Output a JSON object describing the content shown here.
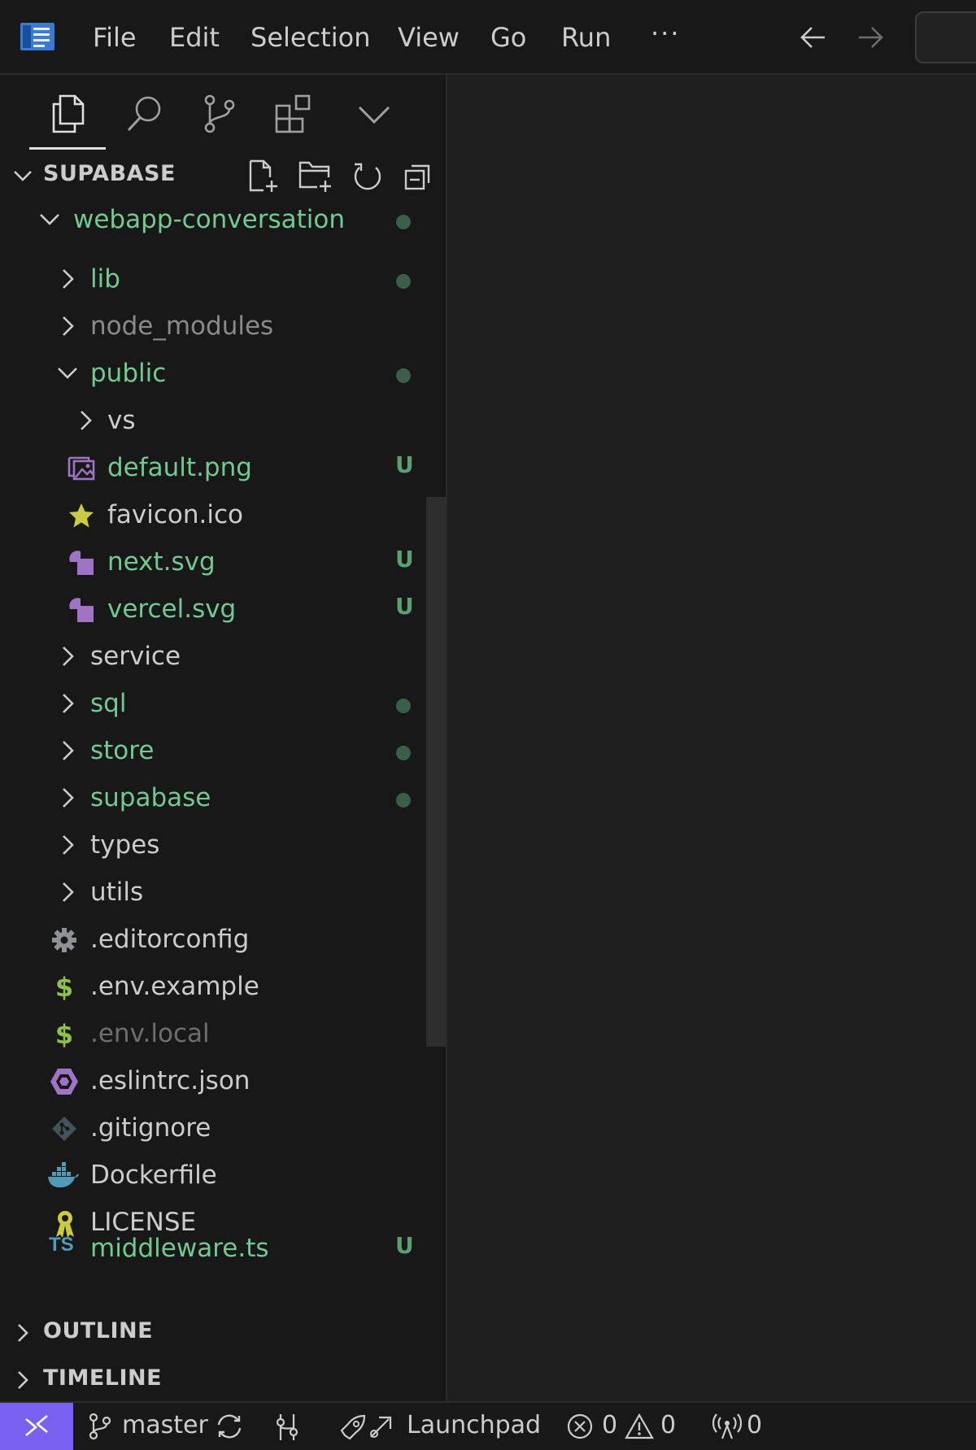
{
  "menu": {
    "items": [
      "File",
      "Edit",
      "Selection",
      "View",
      "Go",
      "Run"
    ],
    "more": "···"
  },
  "sidebar": {
    "explorer_title": "SUPABASE",
    "tree": [
      {
        "label": "webapp-conversation",
        "type": "folder",
        "expanded": true,
        "depth": 1,
        "status": "modified",
        "color": "#73c991"
      },
      {
        "label": "lib",
        "type": "folder",
        "expanded": false,
        "depth": 2,
        "status": "modified",
        "color": "#73c991"
      },
      {
        "label": "node_modules",
        "type": "folder",
        "expanded": false,
        "depth": 2,
        "status": "ignored",
        "color": "#8a8a8a"
      },
      {
        "label": "public",
        "type": "folder",
        "expanded": true,
        "depth": 2,
        "status": "modified",
        "color": "#73c991"
      },
      {
        "label": "vs",
        "type": "folder",
        "expanded": false,
        "depth": 3,
        "status": "",
        "color": "#cccccc"
      },
      {
        "label": "default.png",
        "type": "file",
        "icon": "image-icon",
        "depth": 3,
        "badge": "U",
        "color": "#73c991"
      },
      {
        "label": "favicon.ico",
        "type": "file",
        "icon": "star-icon",
        "depth": 3,
        "badge": "",
        "color": "#cccccc"
      },
      {
        "label": "next.svg",
        "type": "file",
        "icon": "svg-shapes-icon",
        "depth": 3,
        "badge": "U",
        "color": "#73c991"
      },
      {
        "label": "vercel.svg",
        "type": "file",
        "icon": "svg-shapes-icon",
        "depth": 3,
        "badge": "U",
        "color": "#73c991"
      },
      {
        "label": "service",
        "type": "folder",
        "expanded": false,
        "depth": 2,
        "status": "",
        "color": "#cccccc"
      },
      {
        "label": "sql",
        "type": "folder",
        "expanded": false,
        "depth": 2,
        "status": "modified",
        "color": "#73c991"
      },
      {
        "label": "store",
        "type": "folder",
        "expanded": false,
        "depth": 2,
        "status": "modified",
        "color": "#73c991"
      },
      {
        "label": "supabase",
        "type": "folder",
        "expanded": false,
        "depth": 2,
        "status": "modified",
        "color": "#73c991"
      },
      {
        "label": "types",
        "type": "folder",
        "expanded": false,
        "depth": 2,
        "status": "",
        "color": "#cccccc"
      },
      {
        "label": "utils",
        "type": "folder",
        "expanded": false,
        "depth": 2,
        "status": "",
        "color": "#cccccc"
      },
      {
        "label": ".editorconfig",
        "type": "file",
        "icon": "gear-icon",
        "depth": 2,
        "badge": "",
        "color": "#cccccc"
      },
      {
        "label": ".env.example",
        "type": "file",
        "icon": "dollar-icon",
        "depth": 2,
        "badge": "",
        "color": "#cccccc"
      },
      {
        "label": ".env.local",
        "type": "file",
        "icon": "dollar-icon",
        "depth": 2,
        "badge": "",
        "color": "#6e6e6e"
      },
      {
        "label": ".eslintrc.json",
        "type": "file",
        "icon": "eslint-icon",
        "depth": 2,
        "badge": "",
        "color": "#cccccc"
      },
      {
        "label": ".gitignore",
        "type": "file",
        "icon": "git-icon",
        "depth": 2,
        "badge": "",
        "color": "#cccccc"
      },
      {
        "label": "Dockerfile",
        "type": "file",
        "icon": "docker-icon",
        "depth": 2,
        "badge": "",
        "color": "#cccccc"
      },
      {
        "label": "LICENSE",
        "type": "file",
        "icon": "license-icon",
        "depth": 2,
        "badge": "",
        "color": "#cccccc"
      },
      {
        "label": "middleware.ts",
        "type": "file",
        "icon": "typescript-icon",
        "depth": 2,
        "badge": "U",
        "color": "#73c991"
      }
    ],
    "outline_title": "OUTLINE",
    "timeline_title": "TIMELINE",
    "ts_icon_text": "TS"
  },
  "statusbar": {
    "branch": "master",
    "launchpad": "Launchpad",
    "errors": "0",
    "warnings": "0",
    "ports": "0"
  },
  "colors": {
    "accent": "#7a61f2",
    "git_added": "#73c991",
    "background": "#181818"
  }
}
